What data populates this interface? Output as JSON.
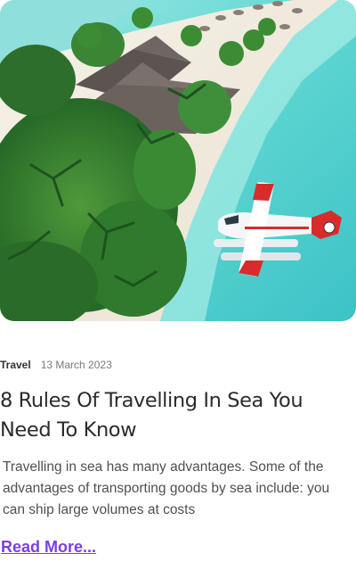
{
  "post": {
    "image_alt": "Aerial view of a tropical island with palm trees and a seaplane on turquoise water",
    "category": "Travel",
    "date": "13 March 2023",
    "title": "8 Rules Of Travelling In Sea You Need To Know",
    "excerpt": "Travelling in sea has many advantages. Some of the advantages of transporting goods by sea include: you can ship large volumes at costs",
    "read_more_label": "Read More..."
  },
  "colors": {
    "accent": "#7b3fe4",
    "sea": "#5fd3d0",
    "sand": "#f2ede3",
    "palm": "#2e7d32"
  }
}
